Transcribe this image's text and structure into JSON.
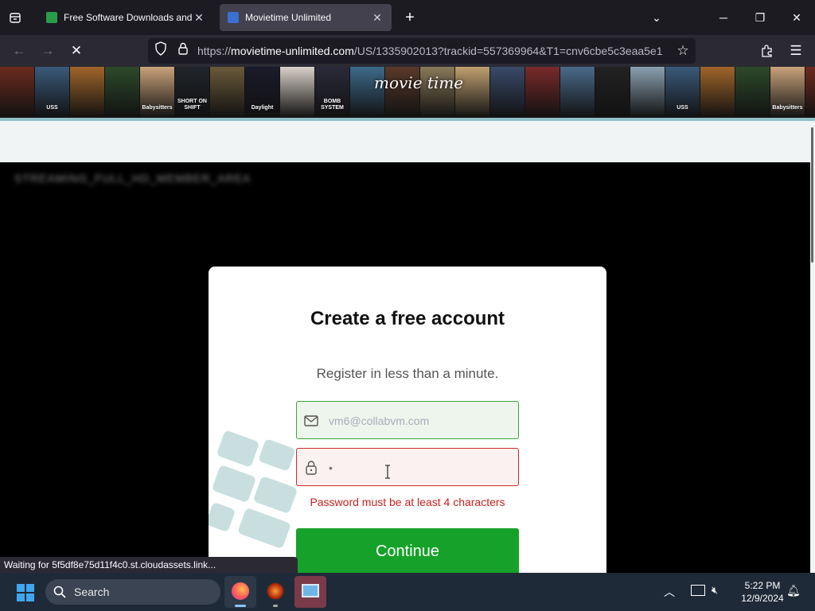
{
  "browser": {
    "tabs": [
      {
        "title": "Free Software Downloads and R",
        "active": false
      },
      {
        "title": "Movietime Unlimited",
        "active": true
      }
    ],
    "url_scheme": "https://",
    "url_domain": "movietime-unlimited.com",
    "url_path": "/US/1335902013?trackid=557369964&T1=cnv6cbe5c3eaa5e1",
    "status_text": "Waiting for 5f5df8e75d11f4c0.st.cloudassets.link..."
  },
  "banner": {
    "logo_text": "movie time",
    "posters": [
      "",
      "USS",
      "",
      "",
      "Babysitters",
      "SHORT ON SHIFT",
      "",
      "Daylight",
      "",
      "BOMB SYSTEM",
      "",
      "",
      "",
      "",
      "",
      "",
      "",
      "",
      "",
      "USS",
      "",
      "",
      "Babysitters",
      ""
    ]
  },
  "page": {
    "blurred_title": "STREAMING_FULL_HD_MEMBER_AREA"
  },
  "modal": {
    "title": "Create a free account",
    "subtitle": "Register in less than a minute.",
    "email_value": "vm6@collabvm.com",
    "password_value": "•",
    "error": "Password must be at least 4 characters",
    "continue_label": "Continue"
  },
  "taskbar": {
    "search_label": "Search",
    "time": "5:22 PM",
    "date": "12/9/2024"
  },
  "colors": {
    "accent_green": "#16a22a",
    "error_red": "#cc1f1f"
  }
}
